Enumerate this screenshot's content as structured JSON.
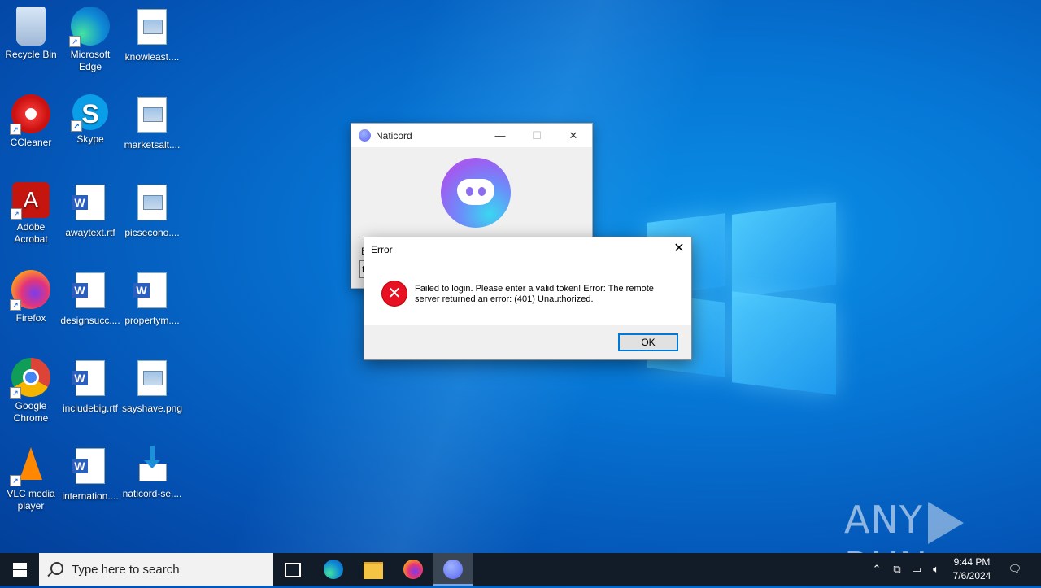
{
  "desktop": {
    "icons": [
      {
        "label": "Recycle Bin"
      },
      {
        "label": "Microsoft Edge"
      },
      {
        "label": "knowleast...."
      },
      {
        "label": "CCleaner"
      },
      {
        "label": "Skype"
      },
      {
        "label": "marketsalt...."
      },
      {
        "label": "Adobe Acrobat"
      },
      {
        "label": "awaytext.rtf"
      },
      {
        "label": "picsecono...."
      },
      {
        "label": "Firefox"
      },
      {
        "label": "designsucc...."
      },
      {
        "label": "propertym...."
      },
      {
        "label": "Google Chrome"
      },
      {
        "label": "includebig.rtf"
      },
      {
        "label": "sayshave.png"
      },
      {
        "label": "VLC media player"
      },
      {
        "label": "internation...."
      },
      {
        "label": "naticord-se...."
      }
    ]
  },
  "naticord_window": {
    "title": "Naticord",
    "hint_letter": "E",
    "field_letter": "t"
  },
  "error_dialog": {
    "title": "Error",
    "message": "Failed to login. Please enter a valid token! Error: The remote server returned an error: (401) Unauthorized.",
    "ok_label": "OK",
    "icon": "error-x-icon"
  },
  "taskbar": {
    "search_placeholder": "Type here to search",
    "time": "9:44 PM",
    "date": "7/6/2024"
  },
  "watermark": {
    "left": "ANY",
    "right": "RUN"
  }
}
